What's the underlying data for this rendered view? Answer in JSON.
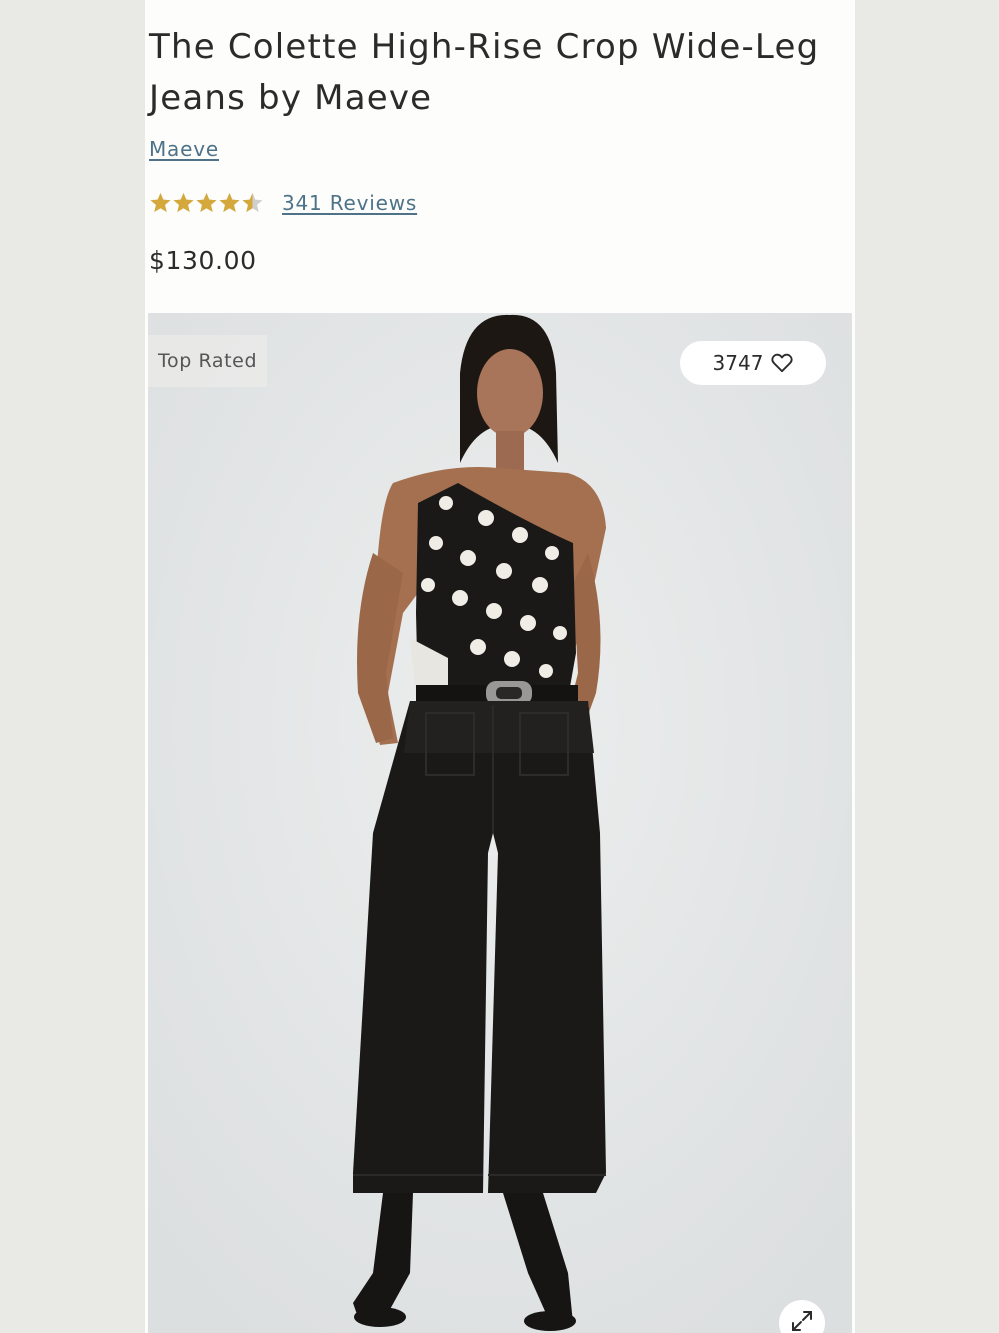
{
  "product": {
    "title": "The Colette High-Rise Crop Wide-Leg Jeans by Maeve",
    "brand": "Maeve",
    "rating": 4.5,
    "rating_max": 5,
    "reviews_label": "341 Reviews",
    "price": "$130.00"
  },
  "image": {
    "badge": "Top Rated",
    "wishlist_count": "3747",
    "icons": {
      "wishlist": "heart-outline-icon",
      "expand": "expand-arrows-icon"
    }
  },
  "colors": {
    "link": "#4e7389",
    "star": "#d4a83a",
    "text": "#2b2b2b"
  }
}
